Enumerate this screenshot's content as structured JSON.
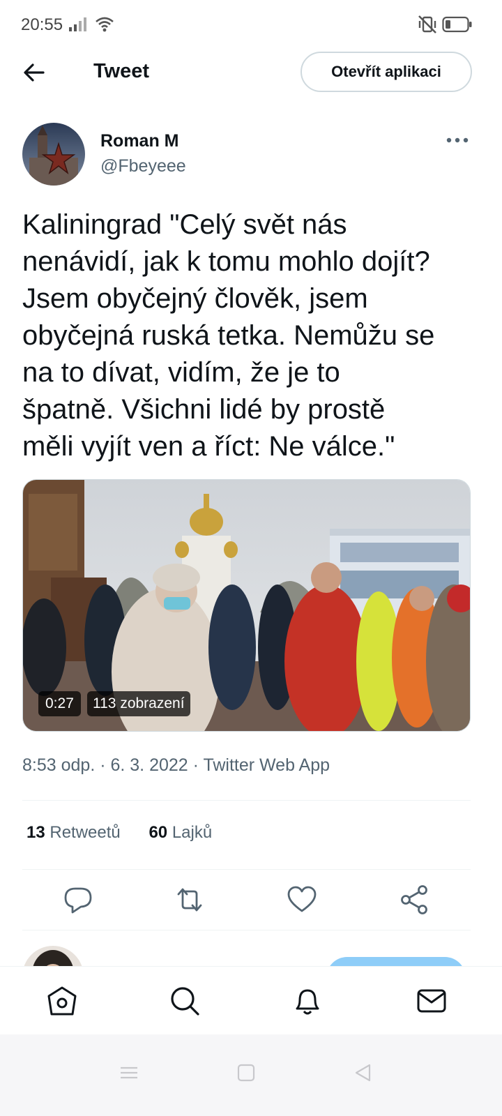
{
  "status_bar": {
    "time": "20:55",
    "icons": [
      "signal-icon",
      "wifi-icon",
      "mute-vibrate-icon",
      "battery-icon"
    ]
  },
  "header": {
    "title": "Tweet",
    "back_icon": "arrow-left-icon",
    "open_app_label": "Otevřít aplikaci"
  },
  "tweet": {
    "author_name": "Roman M",
    "author_handle": "@Fbeyeee",
    "text": "Kaliningrad \"Celý svět nás\nnenávidí, jak k tomu mohlo dojít?\nJsem obyčejný člověk, jsem\nobyčejná ruská tetka. Nemůžu se\nna to dívat, vidím, že je to\nšpatně. Všichni lidé by prostě\nměli vyjít ven a říct: Ne válce.\"",
    "media": {
      "duration": "0:27",
      "views": "113 zobrazení"
    },
    "meta": "8:53 odp. · 6. 3. 2022 · Twitter Web App",
    "retweets_count": "13",
    "retweets_label": "Retweetů",
    "likes_count": "60",
    "likes_label": "Lajků"
  },
  "actions": [
    "reply-icon",
    "retweet-icon",
    "like-icon",
    "share-icon"
  ],
  "bottom_nav": [
    "home-icon",
    "search-icon",
    "notifications-icon",
    "messages-icon"
  ],
  "system_nav": [
    "menu-icon",
    "home-square-icon",
    "back-triangle-icon"
  ],
  "colors": {
    "text": "#0f1419",
    "secondary": "#536471",
    "divider": "#eff3f4",
    "accent_light": "#8ecdf8"
  }
}
